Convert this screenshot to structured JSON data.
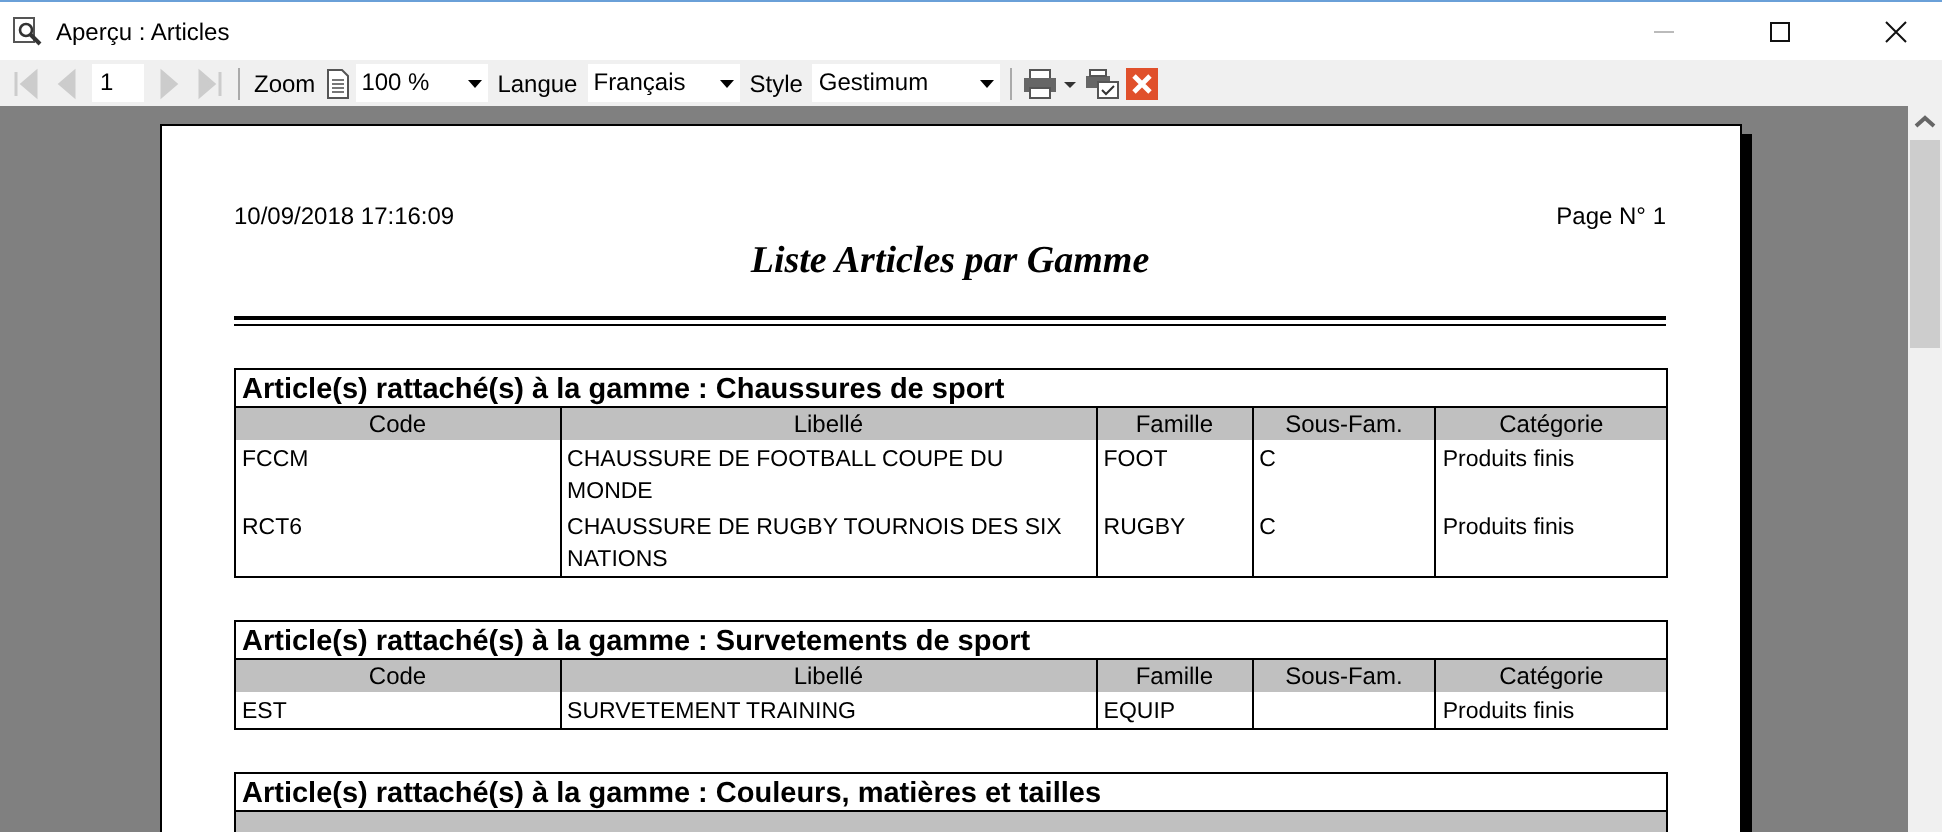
{
  "window": {
    "title": "Aperçu : Articles"
  },
  "toolbar": {
    "nav_buttons": [
      {
        "kind": "first",
        "disabled": true
      },
      {
        "kind": "prev",
        "disabled": true
      }
    ],
    "page": "1",
    "nav_buttons_after": [
      {
        "kind": "next",
        "disabled": true
      },
      {
        "kind": "last",
        "disabled": true
      }
    ],
    "zoom_label": "Zoom",
    "zoom": "100 %",
    "language_label": "Langue",
    "language": "Français",
    "style_label": "Style",
    "style": "Gestimum"
  },
  "report": {
    "timestamp": "10/09/2018 17:16:09",
    "page_number": "Page N° 1",
    "title": "Liste Articles par Gamme",
    "groups": [
      {
        "title": "Article(s) rattaché(s) à la gamme : Chaussures de sport",
        "columns": [
          "Code",
          "Libellé",
          "Famille",
          "Sous-Fam.",
          "Catégorie"
        ],
        "rows": [
          [
            "FCCM",
            "CHAUSSURE DE FOOTBALL COUPE DU MONDE",
            "FOOT",
            "C",
            "Produits finis"
          ],
          [
            "RCT6",
            "CHAUSSURE DE RUGBY TOURNOIS DES SIX NATIONS",
            "RUGBY",
            "C",
            "Produits finis"
          ]
        ]
      },
      {
        "title": "Article(s) rattaché(s) à la gamme : Survetements de sport",
        "columns": [
          "Code",
          "Libellé",
          "Famille",
          "Sous-Fam.",
          "Catégorie"
        ],
        "rows": [
          [
            "EST",
            "SURVETEMENT TRAINING",
            "EQUIP",
            "",
            "Produits finis"
          ]
        ]
      },
      {
        "title": "Article(s) rattaché(s) à la gamme : Couleurs, matières et tailles"
      }
    ]
  }
}
